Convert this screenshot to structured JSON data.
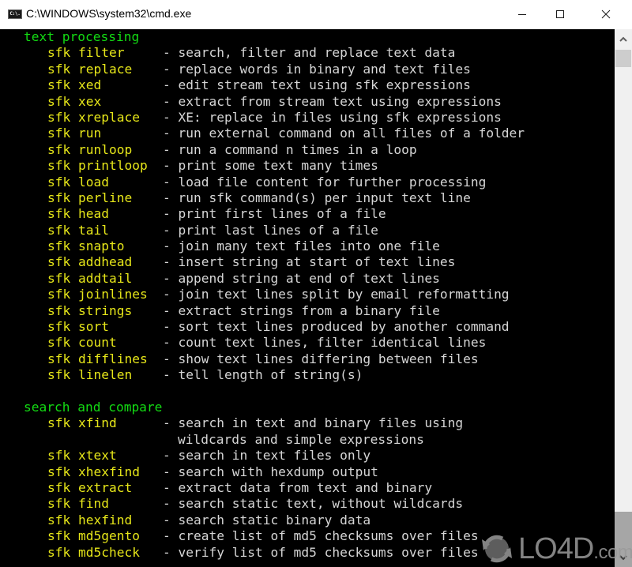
{
  "window": {
    "title": "C:\\WINDOWS\\system32\\cmd.exe",
    "app_icon_label": "C:\\.",
    "controls": {
      "minimize": "minimize",
      "maximize": "maximize",
      "close": "close"
    }
  },
  "colors": {
    "console_bg": "#000000",
    "section_header": "#13dc13",
    "command": "#e6e619",
    "description": "#d6d6d6"
  },
  "console": {
    "sections": [
      {
        "header": "text processing",
        "commands": [
          {
            "cmd": "sfk filter",
            "desc": "- search, filter and replace text data"
          },
          {
            "cmd": "sfk replace",
            "desc": "- replace words in binary and text files"
          },
          {
            "cmd": "sfk xed",
            "desc": "- edit stream text using sfk expressions"
          },
          {
            "cmd": "sfk xex",
            "desc": "- extract from stream text using expressions"
          },
          {
            "cmd": "sfk xreplace",
            "desc": "- XE: replace in files using sfk expressions"
          },
          {
            "cmd": "sfk run",
            "desc": "- run external command on all files of a folder"
          },
          {
            "cmd": "sfk runloop",
            "desc": "- run a command n times in a loop"
          },
          {
            "cmd": "sfk printloop",
            "desc": "- print some text many times"
          },
          {
            "cmd": "sfk load",
            "desc": "- load file content for further processing"
          },
          {
            "cmd": "sfk perline",
            "desc": "- run sfk command(s) per input text line"
          },
          {
            "cmd": "sfk head",
            "desc": "- print first lines of a file"
          },
          {
            "cmd": "sfk tail",
            "desc": "- print last lines of a file"
          },
          {
            "cmd": "sfk snapto",
            "desc": "- join many text files into one file"
          },
          {
            "cmd": "sfk addhead",
            "desc": "- insert string at start of text lines"
          },
          {
            "cmd": "sfk addtail",
            "desc": "- append string at end of text lines"
          },
          {
            "cmd": "sfk joinlines",
            "desc": "- join text lines split by email reformatting"
          },
          {
            "cmd": "sfk strings",
            "desc": "- extract strings from a binary file"
          },
          {
            "cmd": "sfk sort",
            "desc": "- sort text lines produced by another command"
          },
          {
            "cmd": "sfk count",
            "desc": "- count text lines, filter identical lines"
          },
          {
            "cmd": "sfk difflines",
            "desc": "- show text lines differing between files"
          },
          {
            "cmd": "sfk linelen",
            "desc": "- tell length of string(s)"
          }
        ]
      },
      {
        "header": "search and compare",
        "commands": [
          {
            "cmd": "sfk xfind",
            "desc": "- search in text and binary files using",
            "cont": "wildcards and simple expressions"
          },
          {
            "cmd": "sfk xtext",
            "desc": "- search in text files only"
          },
          {
            "cmd": "sfk xhexfind",
            "desc": "- search with hexdump output"
          },
          {
            "cmd": "sfk extract",
            "desc": "- extract data from text and binary"
          },
          {
            "cmd": "sfk find",
            "desc": "- search static text, without wildcards"
          },
          {
            "cmd": "sfk hexfind",
            "desc": "- search static binary data"
          },
          {
            "cmd": "sfk md5gento",
            "desc": "- create list of md5 checksums over files"
          },
          {
            "cmd": "sfk md5check",
            "desc": "- verify list of md5 checksums over files"
          }
        ]
      }
    ]
  },
  "scrollbar": {
    "up_icon": "chevron-up-icon",
    "down_icon": "chevron-down-icon"
  },
  "watermark": {
    "brand": "LO4D",
    "suffix": ".com"
  }
}
